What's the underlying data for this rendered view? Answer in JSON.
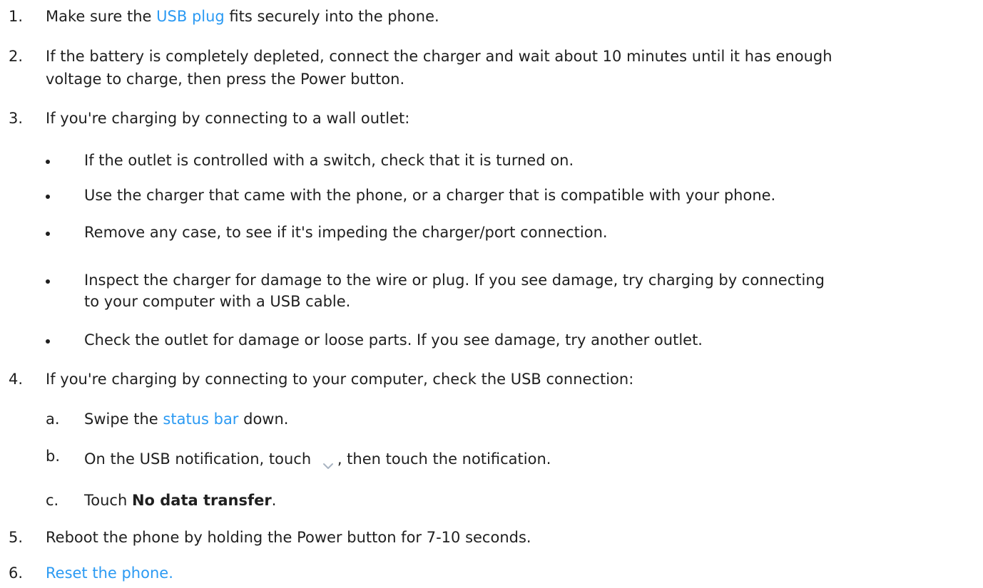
{
  "steps": [
    {
      "marker": "1.",
      "before": "Make sure the ",
      "link": "USB plug",
      "after": " fits securely into the phone."
    },
    {
      "marker": "2.",
      "line1": "If the battery is completely depleted, connect the charger and wait about 10 minutes until it has enough",
      "line2": "voltage to charge, then press the Power button."
    },
    {
      "marker": "3.",
      "text": "If you're charging by connecting to a wall outlet:",
      "bullets": [
        "If the outlet is controlled with a switch, check that it is turned on.",
        "Use the charger that came with the phone, or a charger that is compatible with your phone.",
        "Remove any case, to see if it's impeding the charger/port connection.",
        "Inspect the charger for damage to the wire or plug. If you see damage, try charging by connecting",
        "to your computer with a USB cable.",
        "Check the outlet for damage or loose parts. If you see damage, try another outlet."
      ]
    },
    {
      "marker": "4.",
      "text": "If you're charging by connecting to your computer, check the USB connection:",
      "substeps": [
        {
          "marker": "a.",
          "before": "Swipe the ",
          "link": "status bar",
          "after": " down."
        },
        {
          "marker": "b.",
          "before": "On the USB notification, touch ",
          "icon": "chevron-down-icon",
          "after": ", then touch the notification."
        },
        {
          "marker": "c.",
          "before": "Touch ",
          "bold": "No data transfer",
          "after": "."
        }
      ]
    },
    {
      "marker": "5.",
      "text": "Reboot the phone by holding the Power button for 7-10 seconds."
    },
    {
      "marker": "6.",
      "link": "Reset the phone."
    }
  ],
  "colors": {
    "text": "#1f1f1f",
    "link": "#2b9af3",
    "icon": "#a9b4c2"
  }
}
